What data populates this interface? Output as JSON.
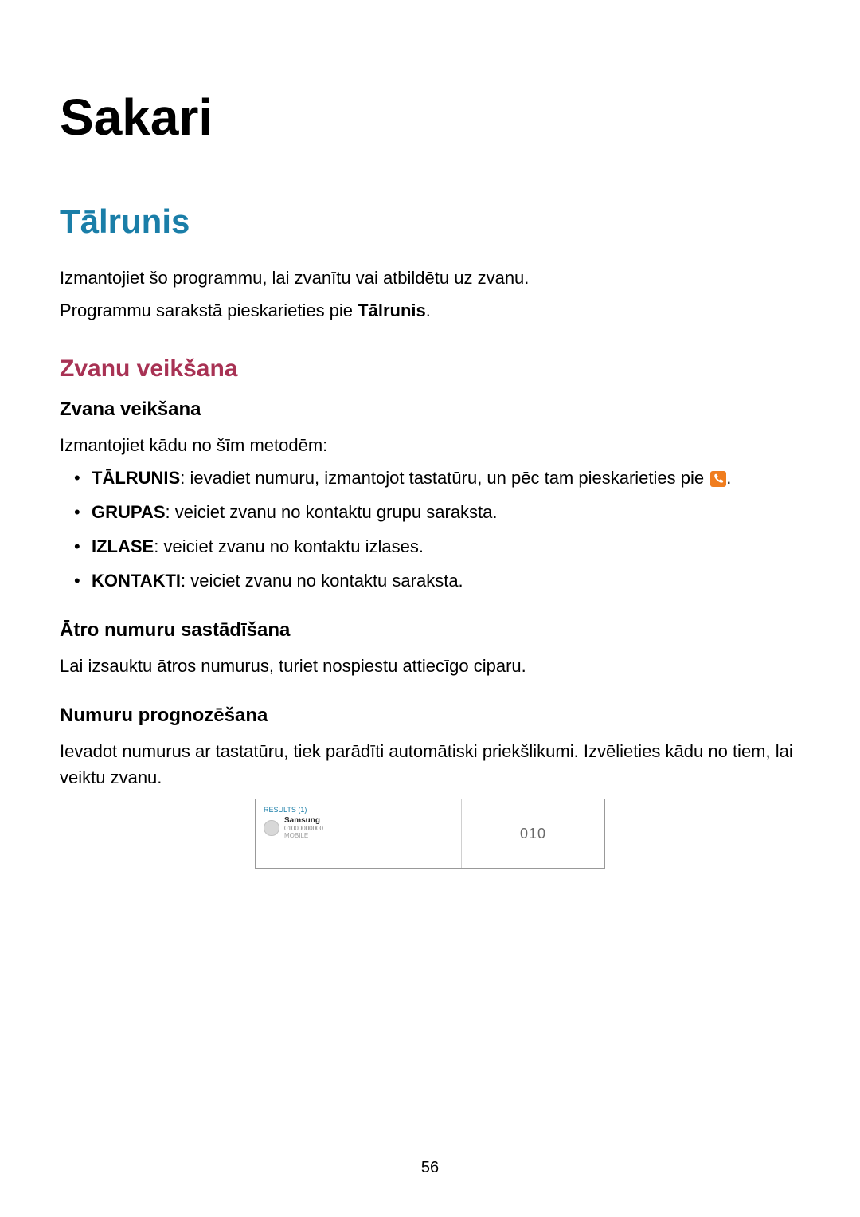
{
  "page": {
    "title": "Sakari",
    "section_title": "Tālrunis",
    "intro_p1": "Izmantojiet šo programmu, lai zvanītu vai atbildētu uz zvanu.",
    "intro_p2_a": "Programmu sarakstā pieskarieties pie ",
    "intro_p2_b": "Tālrunis",
    "intro_p2_c": ".",
    "subsection1": "Zvanu veikšana",
    "sub1_h4_1": "Zvana veikšana",
    "sub1_p1": "Izmantojiet kādu no šīm metodēm:",
    "bullets": {
      "b1_bold": "TĀLRUNIS",
      "b1_rest": ": ievadiet numuru, izmantojot tastatūru, un pēc tam pieskarieties pie ",
      "b1_end": ".",
      "b2_bold": "GRUPAS",
      "b2_rest": ": veiciet zvanu no kontaktu grupu saraksta.",
      "b3_bold": "IZLASE",
      "b3_rest": ": veiciet zvanu no kontaktu izlases.",
      "b4_bold": "KONTAKTI",
      "b4_rest": ": veiciet zvanu no kontaktu saraksta."
    },
    "sub1_h4_2": "Ātro numuru sastādīšana",
    "sub1_p2": "Lai izsauktu ātros numurus, turiet nospiestu attiecīgo ciparu.",
    "sub1_h4_3": "Numuru prognozēšana",
    "sub1_p3": "Ievadot numurus ar tastatūru, tiek parādīti automātiski priekšlikumi. Izvēlieties kādu no tiem, lai veiktu zvanu.",
    "page_number": "56"
  },
  "figure": {
    "results_label": "RESULTS (1)",
    "contact_name": "Samsung",
    "contact_number": "01000000000",
    "contact_extra": "MOBILE",
    "dial": "010"
  }
}
